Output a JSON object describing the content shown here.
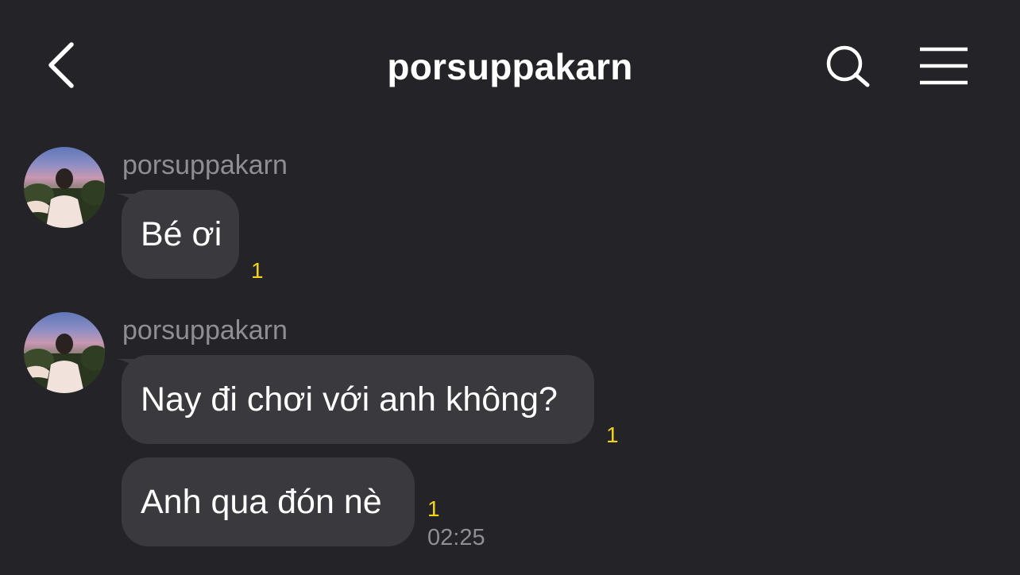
{
  "header": {
    "title": "porsuppakarn"
  },
  "icons": {
    "back": "chevron-left-icon",
    "search": "search-icon",
    "menu": "hamburger-menu-icon"
  },
  "colors": {
    "background": "#242428",
    "bubble": "#3a3a3e",
    "unread": "#f4d21c",
    "muted_text": "#8e8e93"
  },
  "messages": [
    {
      "sender": "porsuppakarn",
      "text": "Bé ơi",
      "unread": "1"
    },
    {
      "sender": "porsuppakarn",
      "text": "Nay đi chơi với anh không?",
      "unread": "1"
    },
    {
      "text": "Anh qua đón nè",
      "unread": "1",
      "time": "02:25"
    }
  ]
}
